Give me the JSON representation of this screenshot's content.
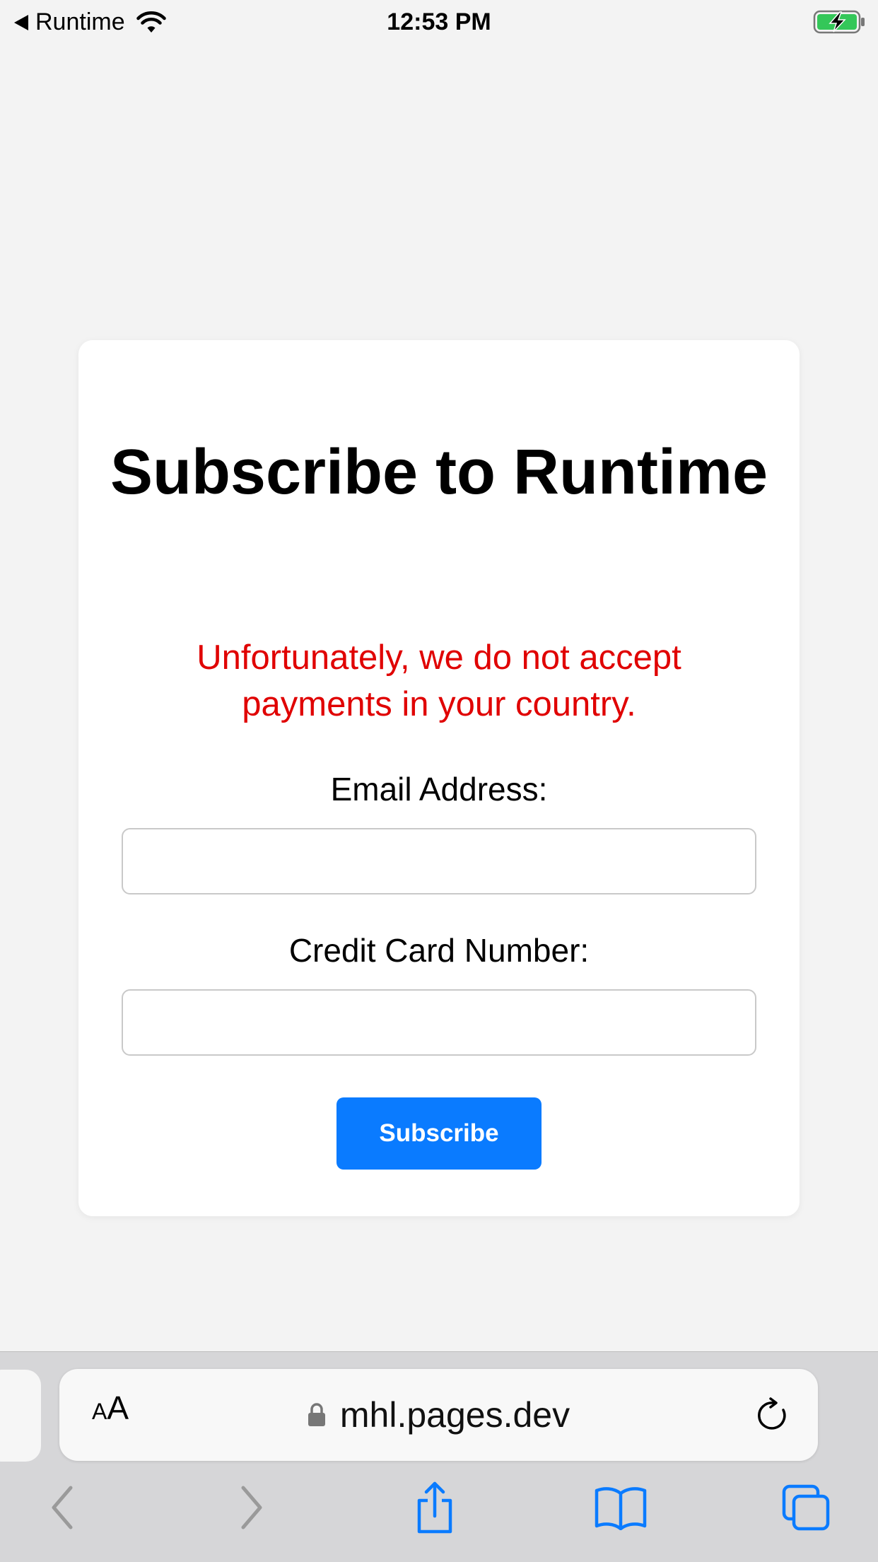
{
  "status_bar": {
    "back_app": "Runtime",
    "time": "12:53 PM",
    "icons": [
      "back-arrow-icon",
      "wifi-icon",
      "battery-charging-icon"
    ],
    "battery_color": "#34c759"
  },
  "form": {
    "title": "Subscribe to Runtime",
    "error_message": "Unfortunately, we do not accept payments in your country.",
    "email_label": "Email Address:",
    "email_value": "",
    "card_label": "Credit Card Number:",
    "card_value": "",
    "submit_label": "Subscribe",
    "colors": {
      "error": "#e00000",
      "button": "#0a7bff"
    }
  },
  "browser": {
    "text_size_label_small": "A",
    "text_size_label_big": "A",
    "url": "mhl.pages.dev",
    "icons": [
      "lock-icon",
      "reload-icon",
      "back-icon",
      "forward-icon",
      "share-icon",
      "bookmarks-icon",
      "tabs-icon"
    ],
    "accent_color": "#0a7bff"
  }
}
